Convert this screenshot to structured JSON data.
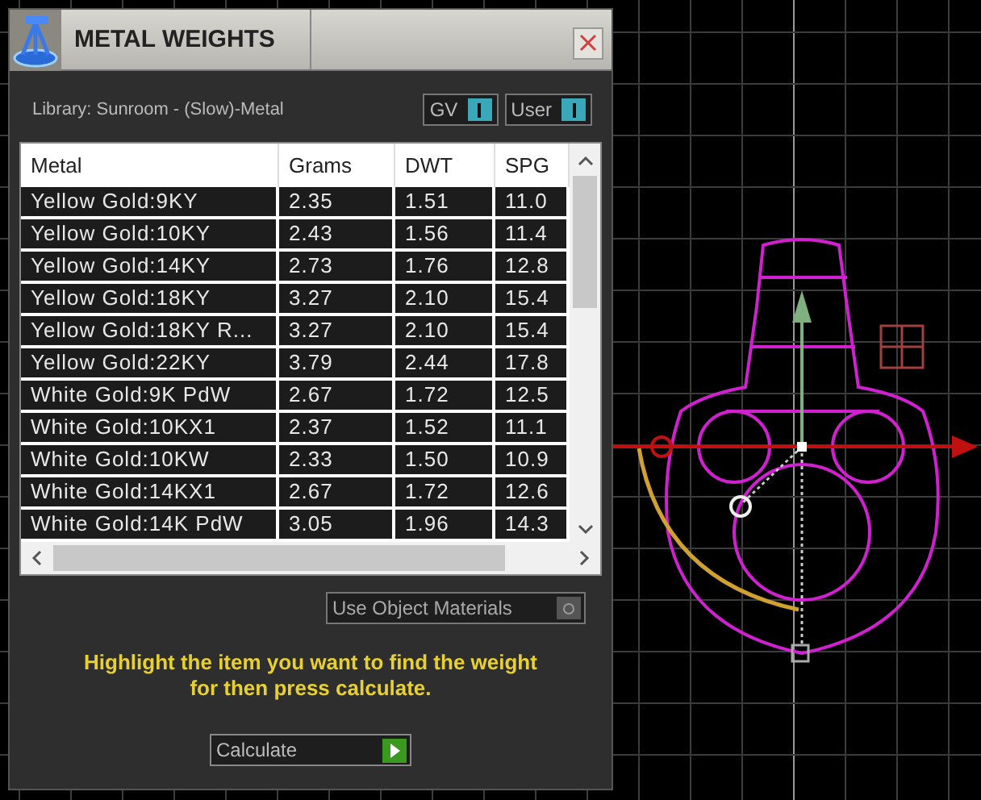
{
  "window": {
    "title": "METAL WEIGHTS"
  },
  "library": "Library: Sunroom - (Slow)-Metal",
  "toggles": [
    {
      "label": "GV",
      "on": true
    },
    {
      "label": "User",
      "on": true
    }
  ],
  "table": {
    "columns": [
      "Metal",
      "Grams",
      "DWT",
      "SPG"
    ],
    "rows": [
      [
        "Yellow Gold:9KY",
        "2.35",
        "1.51",
        "11.0"
      ],
      [
        "Yellow Gold:10KY",
        "2.43",
        "1.56",
        "11.4"
      ],
      [
        "Yellow Gold:14KY",
        "2.73",
        "1.76",
        "12.8"
      ],
      [
        "Yellow Gold:18KY",
        "3.27",
        "2.10",
        "15.4"
      ],
      [
        "Yellow Gold:18KY R...",
        "3.27",
        "2.10",
        "15.4"
      ],
      [
        "Yellow Gold:22KY",
        "3.79",
        "2.44",
        "17.8"
      ],
      [
        "White Gold:9K PdW",
        "2.67",
        "1.72",
        "12.5"
      ],
      [
        "White Gold:10KX1",
        "2.37",
        "1.52",
        "11.1"
      ],
      [
        "White Gold:10KW",
        "2.33",
        "1.50",
        "10.9"
      ],
      [
        "White Gold:14KX1",
        "2.67",
        "1.72",
        "12.6"
      ],
      [
        "White Gold:14K PdW",
        "3.05",
        "1.96",
        "14.3"
      ]
    ]
  },
  "use_object_materials": {
    "label": "Use Object Materials",
    "checked": false
  },
  "hint": [
    "Highlight the item you want to find the weight",
    "for then press calculate."
  ],
  "calculate_button": "Calculate"
}
